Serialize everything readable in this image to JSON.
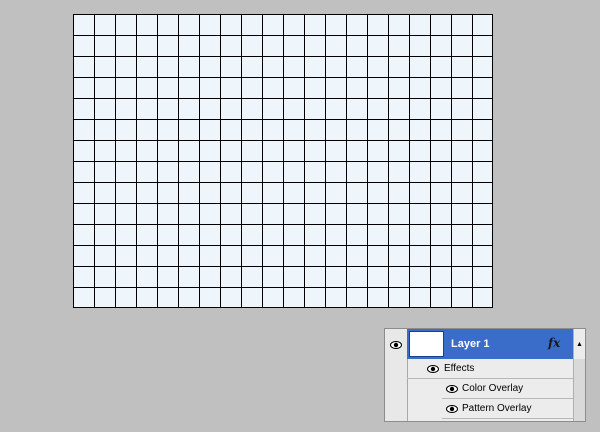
{
  "layers_panel": {
    "layer": {
      "name": "Layer 1",
      "fx_label": "fx"
    },
    "effects_label": "Effects",
    "effects": [
      {
        "label": "Color Overlay"
      },
      {
        "label": "Pattern Overlay"
      }
    ],
    "scroll_up_glyph": "▲"
  },
  "colors": {
    "background": "#c0c0c0",
    "canvas_fill": "#eef5fb",
    "grid_lines": "#000000",
    "selected_layer": "#3a6cc9"
  }
}
